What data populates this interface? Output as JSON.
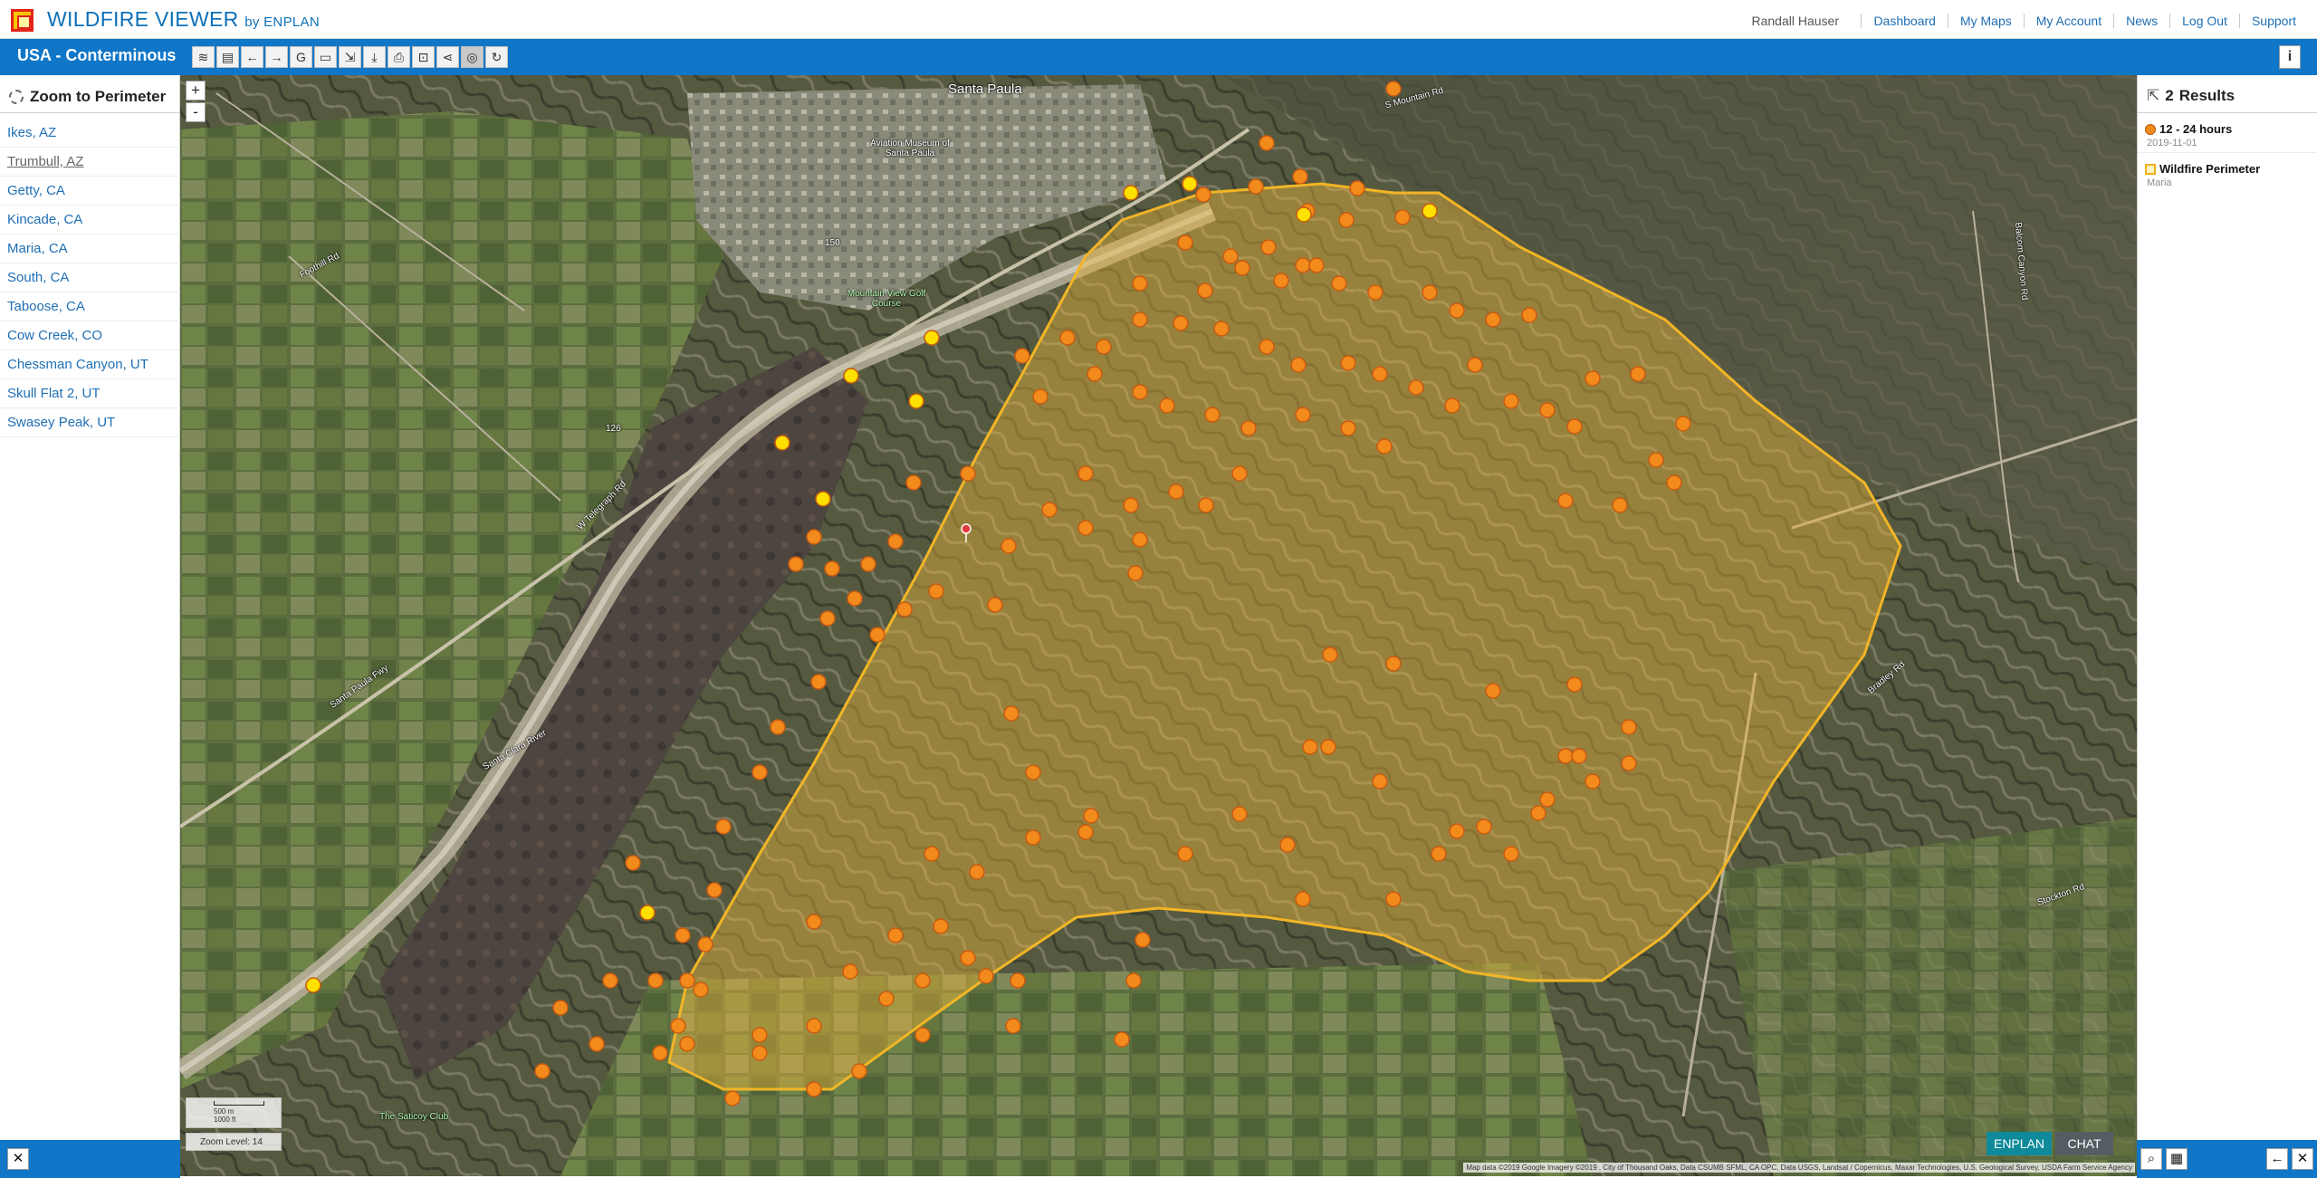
{
  "header": {
    "app_title": "WILDFIRE VIEWER",
    "app_by": "by ENPLAN",
    "user_name": "Randall Hauser",
    "links": [
      "Dashboard",
      "My Maps",
      "My Account",
      "News",
      "Log Out",
      "Support"
    ]
  },
  "toolbar": {
    "region": "USA - Conterminous",
    "tools": [
      {
        "icon": "layers-icon",
        "glyph": "≋"
      },
      {
        "icon": "page-icon",
        "glyph": "▤"
      },
      {
        "icon": "arrow-left-icon",
        "glyph": "←"
      },
      {
        "icon": "arrow-right-icon",
        "glyph": "→"
      },
      {
        "icon": "g-icon",
        "glyph": "G"
      },
      {
        "icon": "measure-icon",
        "glyph": "▭"
      },
      {
        "icon": "select-icon",
        "glyph": "⇲"
      },
      {
        "icon": "download-icon",
        "glyph": "⤓"
      },
      {
        "icon": "print-icon",
        "glyph": "⎙"
      },
      {
        "icon": "bookmark-icon",
        "glyph": "⊡"
      },
      {
        "icon": "share-icon",
        "glyph": "⋖"
      },
      {
        "icon": "zoom-perimeter-icon",
        "glyph": "◎"
      },
      {
        "icon": "refresh-icon",
        "glyph": "↻"
      }
    ],
    "info_glyph": "i"
  },
  "left_panel": {
    "heading": "Zoom to Perimeter",
    "perimeters": [
      "Ikes, AZ",
      "Trumbull, AZ",
      "Getty, CA",
      "Kincade, CA",
      "Maria, CA",
      "South, CA",
      "Taboose, CA",
      "Cow Creek, CO",
      "Chessman Canyon, UT",
      "Skull Flat 2, UT",
      "Swasey Peak, UT"
    ],
    "visited_index": 1
  },
  "map": {
    "zoom_in": "+",
    "zoom_out": "-",
    "scale_top": "500 m",
    "scale_bottom": "1000 ft",
    "zoom_level": "Zoom Level: 14",
    "attribution": "Map data ©2019 Google Imagery ©2019 , City of Thousand Oaks, Data CSUMB SFML, CA OPC, Data USGS, Landsat / Copernicus, Maxar Technologies, U.S. Geological Survey, USDA Farm Service Agency",
    "labels": {
      "santa_paula": "Santa Paula",
      "aviation_museum": "Aviation Museum of Santa Paula",
      "mountain_view": "Mountain View Golf Course",
      "santa_clara_river": "Santa Clara River",
      "saticoy_club": "The Saticoy Club",
      "foothill_rd": "Foothill Rd",
      "telegraph_rd": "W Telegraph Rd",
      "santa_paula_fwy": "Santa Paula Fwy",
      "bradley_rd": "Bradley Rd",
      "balcom_canyon_rd": "Balcom Canyon Rd",
      "stockton_rd": "Stockton Rd",
      "s_mountain_rd": "S Mountain Rd",
      "route_126": "126",
      "route_150": "150"
    }
  },
  "right_panel": {
    "results_count": "2",
    "results_label": "Results",
    "results": [
      {
        "title": "12 - 24 hours",
        "sub": "2019-11-01",
        "swatch": "fire"
      },
      {
        "title": "Wildfire Perimeter",
        "sub": "Maria",
        "swatch": "perimeter"
      }
    ]
  },
  "bottom": {
    "close_glyph": "✕",
    "enplan_tab": "ENPLAN",
    "chat_tab": "CHAT"
  },
  "colors": {
    "brand_blue": "#0f76c8",
    "link_blue": "#1f6fb5",
    "perimeter_stroke": "#f2b526",
    "hotspot_orange": "#f28a1c",
    "hotspot_yellow": "#ffe000"
  }
}
